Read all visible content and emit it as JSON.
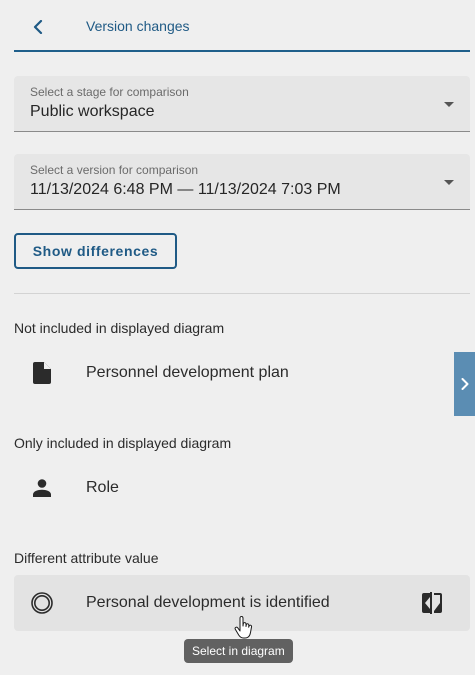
{
  "header": {
    "back_icon": "chevron-left-icon",
    "title": "Version changes"
  },
  "stage_select": {
    "label": "Select a stage for comparison",
    "value": "Public workspace"
  },
  "version_select": {
    "label": "Select a version for comparison",
    "value": "11/13/2024 6:48 PM — 11/13/2024 7:03 PM"
  },
  "show_differences_label": "Show differences",
  "sections": {
    "not_included": {
      "heading": "Not included in displayed diagram",
      "item": {
        "icon": "document-icon",
        "label": "Personnel development plan"
      }
    },
    "only_included": {
      "heading": "Only included in displayed diagram",
      "item": {
        "icon": "person-icon",
        "label": "Role"
      }
    },
    "different_attribute": {
      "heading": "Different attribute value",
      "item": {
        "icon": "event-circle-icon",
        "label": "Personal development is identified",
        "action_icon": "compare-icon"
      }
    }
  },
  "tooltip": "Select in diagram",
  "colors": {
    "accent": "#1f5a85",
    "side_tab": "#5b8db3",
    "background": "#efefef"
  }
}
